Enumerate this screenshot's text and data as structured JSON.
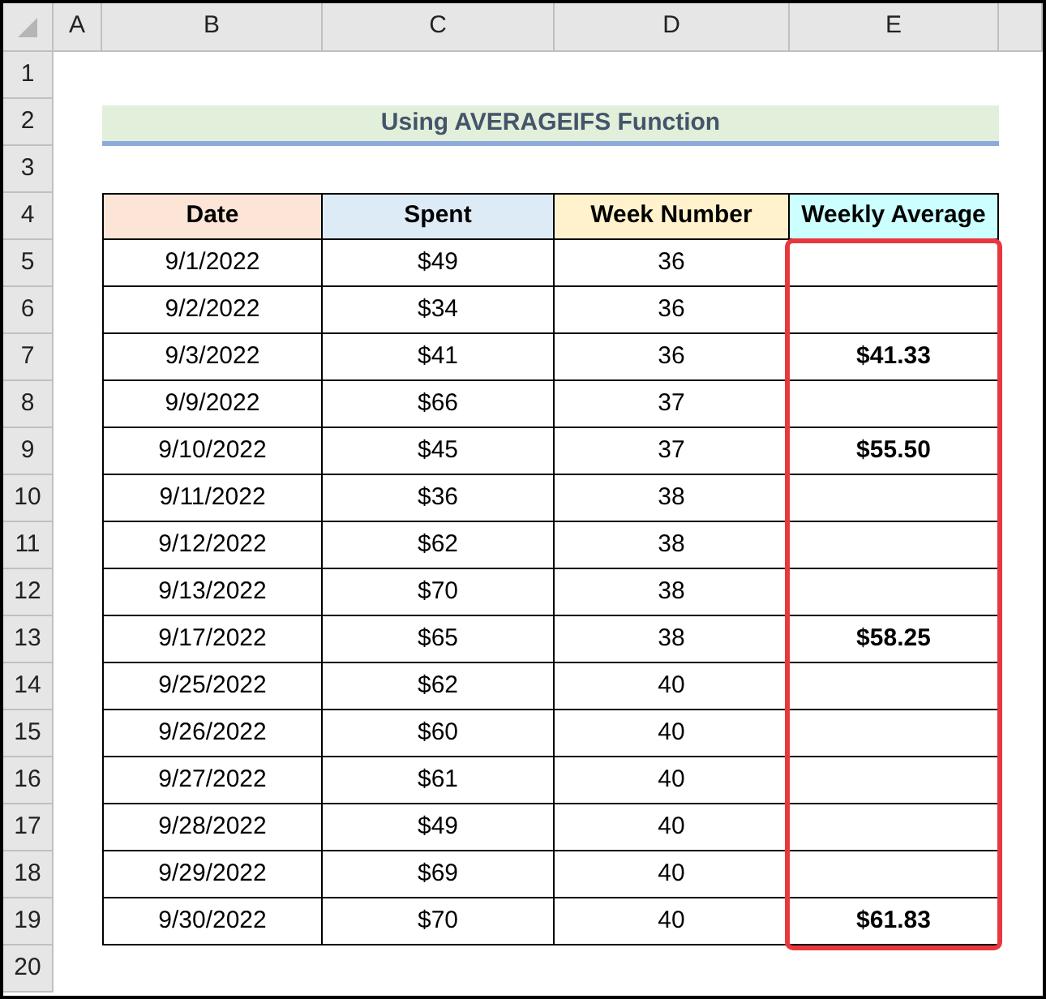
{
  "column_headers": [
    "A",
    "B",
    "C",
    "D",
    "E"
  ],
  "row_numbers": [
    "1",
    "2",
    "3",
    "4",
    "5",
    "6",
    "7",
    "8",
    "9",
    "10",
    "11",
    "12",
    "13",
    "14",
    "15",
    "16",
    "17",
    "18",
    "19",
    "20"
  ],
  "title": "Using AVERAGEIFS Function",
  "table": {
    "columns": [
      {
        "label": "Date",
        "color": "#fce4d6",
        "highlighted": false
      },
      {
        "label": "Spent",
        "color": "#ddebf7",
        "highlighted": false
      },
      {
        "label": "Week Number",
        "color": "#fff2cc",
        "highlighted": false
      },
      {
        "label": "Weekly Average",
        "color": "#ccffff",
        "highlighted": true
      }
    ],
    "rows": [
      [
        "9/1/2022",
        "$49",
        "36",
        ""
      ],
      [
        "9/2/2022",
        "$34",
        "36",
        ""
      ],
      [
        "9/3/2022",
        "$41",
        "36",
        "$41.33"
      ],
      [
        "9/9/2022",
        "$66",
        "37",
        ""
      ],
      [
        "9/10/2022",
        "$45",
        "37",
        "$55.50"
      ],
      [
        "9/11/2022",
        "$36",
        "38",
        ""
      ],
      [
        "9/12/2022",
        "$62",
        "38",
        ""
      ],
      [
        "9/13/2022",
        "$70",
        "38",
        ""
      ],
      [
        "9/17/2022",
        "$65",
        "38",
        "$58.25"
      ],
      [
        "9/25/2022",
        "$62",
        "40",
        ""
      ],
      [
        "9/26/2022",
        "$60",
        "40",
        ""
      ],
      [
        "9/27/2022",
        "$61",
        "40",
        ""
      ],
      [
        "9/28/2022",
        "$49",
        "40",
        ""
      ],
      [
        "9/29/2022",
        "$69",
        "40",
        ""
      ],
      [
        "9/30/2022",
        "$70",
        "40",
        "$61.83"
      ]
    ]
  }
}
